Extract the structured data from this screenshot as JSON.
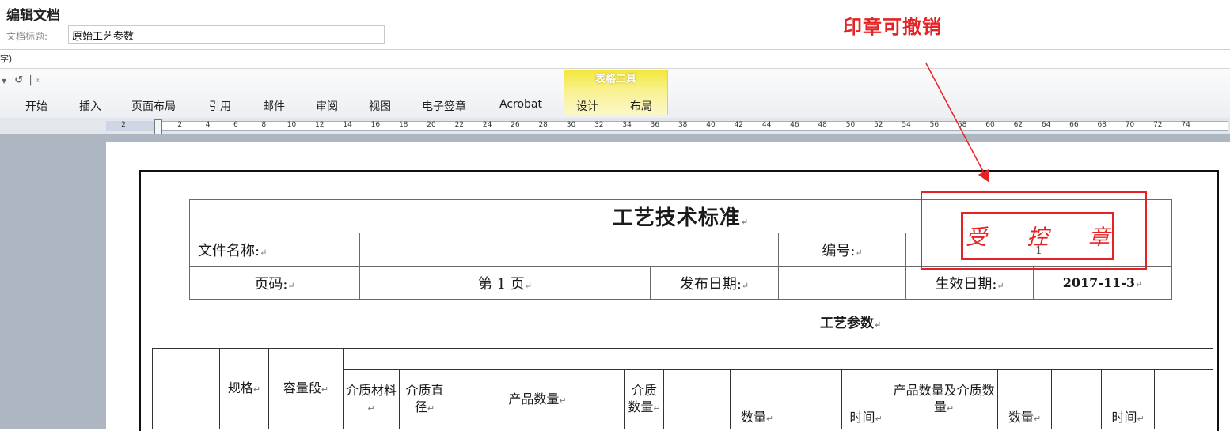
{
  "app": {
    "title": "编辑文档"
  },
  "doc_title": {
    "label": "文档标题:",
    "value": "原始工艺参数"
  },
  "fragment": "字)",
  "ribbon": {
    "contextual_group": "表格工具",
    "tabs": [
      "开始",
      "插入",
      "页面布局",
      "引用",
      "邮件",
      "审阅",
      "视图",
      "电子签章",
      "Acrobat",
      "设计",
      "布局"
    ]
  },
  "ruler": {
    "ticks": [
      "2",
      "2",
      "4",
      "6",
      "8",
      "10",
      "12",
      "14",
      "16",
      "18",
      "20",
      "22",
      "24",
      "26",
      "28",
      "30",
      "32",
      "34",
      "36",
      "38",
      "40",
      "42",
      "44",
      "46",
      "48",
      "50",
      "52",
      "54",
      "56",
      "58",
      "60",
      "62",
      "64",
      "66",
      "68",
      "70",
      "72",
      "74"
    ]
  },
  "annotation": {
    "text": "印章可撤销"
  },
  "header_table": {
    "title": "工艺技术标准",
    "file_name_label": "文件名称:",
    "number_label": "编号:",
    "page_label": "页码:",
    "page_value": "第 1 页",
    "issue_date_label": "发布日期:",
    "effective_date_label": "生效日期:",
    "effective_date_value": "2017-11-3",
    "number_value": "1"
  },
  "stamp": {
    "chars": [
      "受",
      "控",
      "章"
    ]
  },
  "section_title": "工艺参数",
  "params_table": {
    "headers": {
      "spec": "规格",
      "capacity": "容量段",
      "medium_material": "介质材料",
      "medium_diameter": "介质直径",
      "product_qty": "产品数量",
      "medium_qty": "介质数量",
      "qty": "数量",
      "time": "时间",
      "product_medium_qty": "产品数量及介质数量",
      "qty2": "数量",
      "time2": "时间"
    }
  },
  "colors": {
    "stamp": "#e52224",
    "annotation": "#e52224",
    "context_tab": "#f4e83a"
  }
}
